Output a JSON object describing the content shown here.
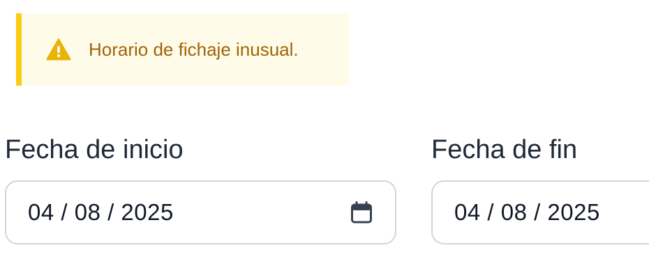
{
  "alert": {
    "icon": "warning-triangle-icon",
    "message": "Horario de fichaje inusual.",
    "accent_color": "#facc15",
    "text_color": "#a16207",
    "background_color": "#fefce8"
  },
  "start_date": {
    "label": "Fecha de inicio",
    "value": "04 / 08 / 2025",
    "icon": "calendar-icon"
  },
  "end_date": {
    "label": "Fecha de fin",
    "value": "04 / 08 / 2025"
  }
}
